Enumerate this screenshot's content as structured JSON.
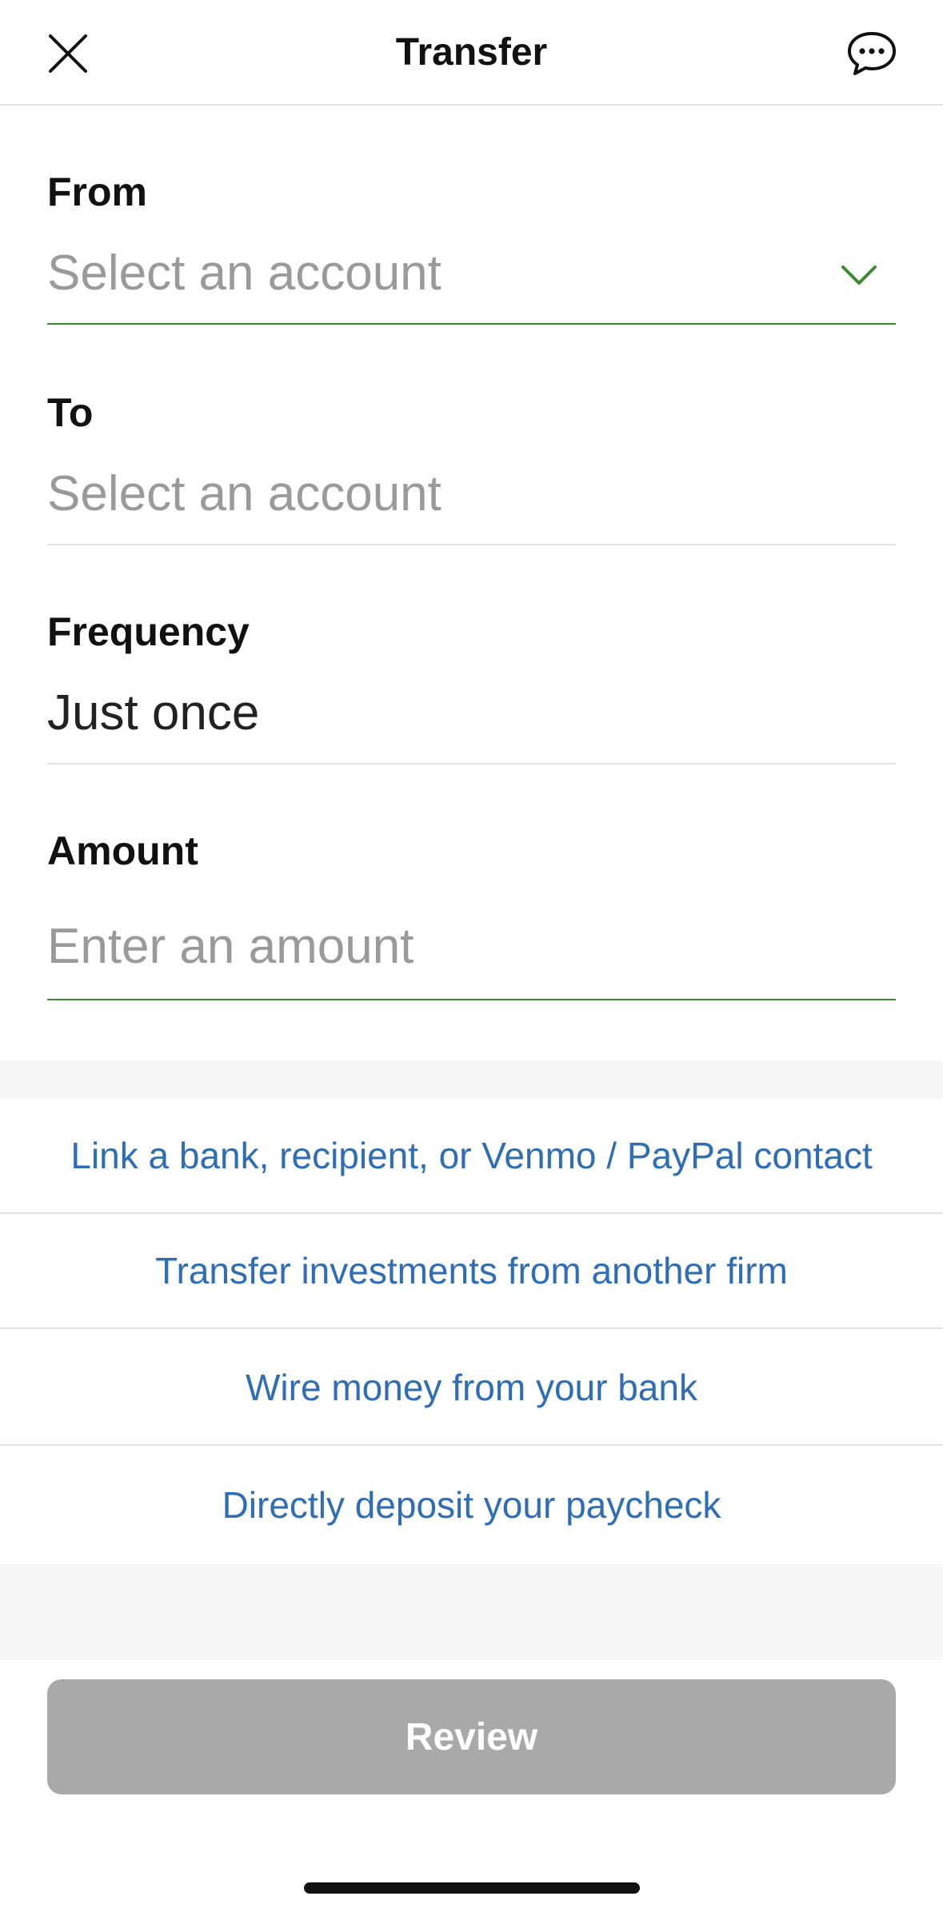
{
  "header": {
    "title": "Transfer",
    "close_icon": "close-icon",
    "chat_icon": "chat-bubble-icon"
  },
  "form": {
    "from": {
      "label": "From",
      "placeholder": "Select an account"
    },
    "to": {
      "label": "To",
      "placeholder": "Select an account"
    },
    "frequency": {
      "label": "Frequency",
      "value": "Just once"
    },
    "amount": {
      "label": "Amount",
      "placeholder": "Enter an amount"
    }
  },
  "links": [
    {
      "label": "Link a bank, recipient, or Venmo / PayPal contact"
    },
    {
      "label": "Transfer investments from another firm"
    },
    {
      "label": "Wire money from your bank"
    },
    {
      "label": "Directly deposit your paycheck"
    }
  ],
  "review_button": {
    "label": "Review"
  },
  "colors": {
    "accent_green": "#3b8a2e",
    "link_blue": "#2f6db5",
    "disabled_button": "#a9a9a9"
  }
}
